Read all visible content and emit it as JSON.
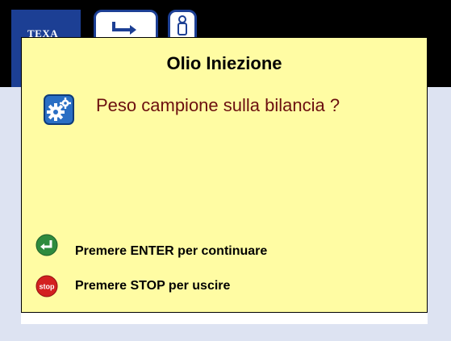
{
  "toolbar": {
    "logo_text": "TEXA",
    "buttons": [
      {
        "icon": "enter-arrow-icon"
      },
      {
        "icon": "person-icon"
      }
    ]
  },
  "dialog": {
    "title": "Olio Iniezione",
    "icon": "gears-icon",
    "question": "Peso campione sulla bilancia ?",
    "hints": [
      {
        "icon": "enter-key-icon",
        "icon_color": "#2e8b3e",
        "text": "Premere ENTER per continuare"
      },
      {
        "icon": "stop-sign-icon",
        "icon_color": "#d32020",
        "icon_label": "stop",
        "text": "Premere STOP per uscire"
      }
    ]
  },
  "colors": {
    "toolbar_bg": "#000000",
    "brand_blue": "#1c3f94",
    "dialog_bg": "#fffca3",
    "question_text": "#6b0f0f",
    "screen_band": "#dde3f2"
  }
}
